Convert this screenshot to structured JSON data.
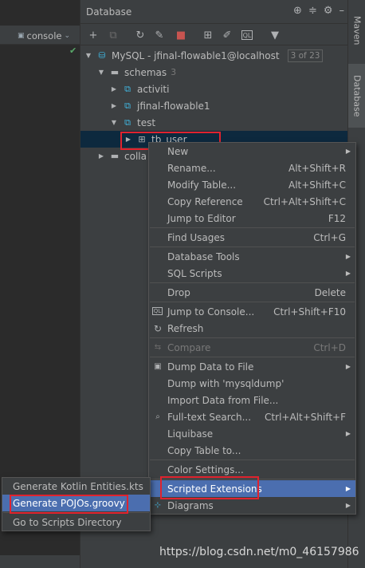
{
  "left": {
    "console_label": "console"
  },
  "panel": {
    "title": "Database"
  },
  "tree": {
    "connection": {
      "label": "MySQL - jfinal-flowable1@localhost",
      "badge": "3 of 23"
    },
    "schemas": {
      "label": "schemas",
      "count": "3"
    },
    "items": [
      {
        "label": "activiti"
      },
      {
        "label": "jfinal-flowable1"
      },
      {
        "label": "test"
      }
    ],
    "table": {
      "label": "tb_user"
    },
    "collations": {
      "label": "colla"
    }
  },
  "right_tabs": {
    "maven": "Maven",
    "database": "Database"
  },
  "context_menu": {
    "items": [
      {
        "label": "New",
        "shortcut": ""
      },
      {
        "label": "Rename...",
        "shortcut": "Alt+Shift+R"
      },
      {
        "label": "Modify Table...",
        "shortcut": "Alt+Shift+C"
      },
      {
        "label": "Copy Reference",
        "shortcut": "Ctrl+Alt+Shift+C"
      },
      {
        "label": "Jump to Editor",
        "shortcut": "F12"
      },
      {
        "label": "Find Usages",
        "shortcut": "Ctrl+G"
      },
      {
        "label": "Database Tools",
        "shortcut": ""
      },
      {
        "label": "SQL Scripts",
        "shortcut": ""
      },
      {
        "label": "Drop",
        "shortcut": "Delete"
      },
      {
        "label": "Jump to Console...",
        "shortcut": "Ctrl+Shift+F10"
      },
      {
        "label": "Refresh",
        "shortcut": ""
      },
      {
        "label": "Compare",
        "shortcut": "Ctrl+D"
      },
      {
        "label": "Dump Data to File",
        "shortcut": ""
      },
      {
        "label": "Dump with 'mysqldump'",
        "shortcut": ""
      },
      {
        "label": "Import Data from File...",
        "shortcut": ""
      },
      {
        "label": "Full-text Search...",
        "shortcut": "Ctrl+Alt+Shift+F"
      },
      {
        "label": "Liquibase",
        "shortcut": ""
      },
      {
        "label": "Copy Table to...",
        "shortcut": ""
      },
      {
        "label": "Color Settings...",
        "shortcut": ""
      },
      {
        "label": "Scripted Extensions",
        "shortcut": ""
      },
      {
        "label": "Diagrams",
        "shortcut": ""
      }
    ]
  },
  "submenu": {
    "items": [
      {
        "label": "Generate Kotlin Entities.kts"
      },
      {
        "label": "Generate POJOs.groovy"
      },
      {
        "label": "Go to Scripts Directory"
      }
    ]
  },
  "watermark": "https://blog.csdn.net/m0_46157986",
  "colors": {
    "background": "#3c3f41",
    "editor": "#2b2b2b",
    "selection": "#4b6eaf",
    "tree_selection": "#0d293e",
    "highlight_box": "#e0232e",
    "schema_icon": "#40b6e0"
  }
}
